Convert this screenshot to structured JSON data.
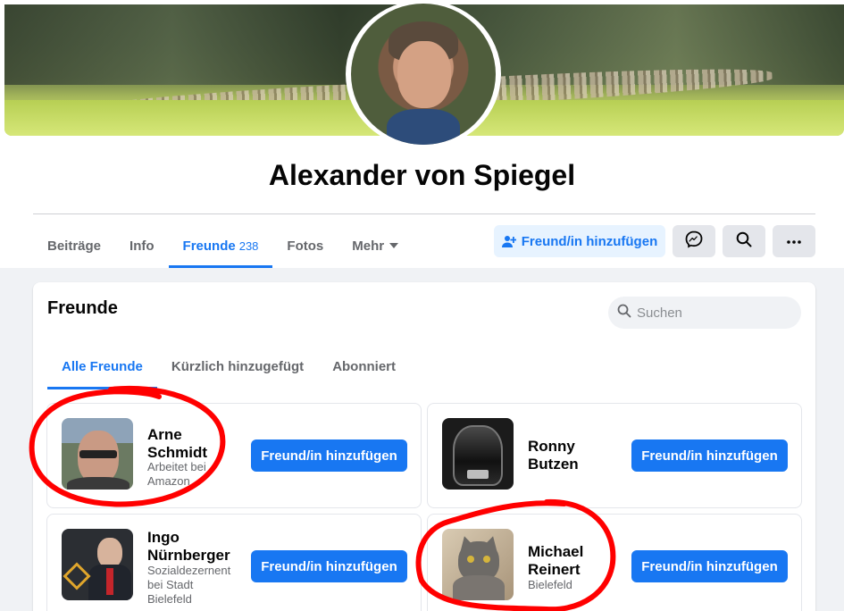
{
  "profile": {
    "name": "Alexander von Spiegel"
  },
  "nav": {
    "tabs": [
      {
        "label": "Beiträge"
      },
      {
        "label": "Info"
      },
      {
        "label": "Freunde",
        "count": "238"
      },
      {
        "label": "Fotos"
      },
      {
        "label": "Mehr"
      }
    ],
    "add_friend_label": "Freund/in hinzufügen",
    "icons": {
      "add": "add-friend-icon",
      "messenger": "messenger-icon",
      "search": "search-icon",
      "more": "more-icon"
    }
  },
  "friends_section": {
    "title": "Freunde",
    "search_placeholder": "Suchen",
    "subtabs": [
      {
        "label": "Alle Freunde"
      },
      {
        "label": "Kürzlich hinzugefügt"
      },
      {
        "label": "Abonniert"
      }
    ],
    "friends": [
      {
        "name": "Arne Schmidt",
        "subtitle": "Arbeitet bei Amazon",
        "button": "Freund/in hinzufügen"
      },
      {
        "name": "Ronny Butzen",
        "subtitle": "",
        "button": "Freund/in hinzufügen"
      },
      {
        "name": "Ingo Nürnberger",
        "subtitle": "Sozialdezernent bei Stadt Bielefeld",
        "button": "Freund/in hinzufügen"
      },
      {
        "name": "Michael Reinert",
        "subtitle": "Bielefeld",
        "button": "Freund/in hinzufügen"
      }
    ]
  },
  "colors": {
    "accent": "#1877f2",
    "annotation": "#ff0000"
  }
}
